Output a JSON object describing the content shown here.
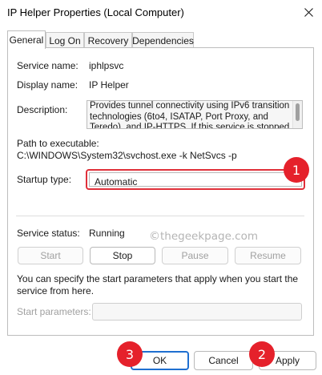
{
  "window": {
    "title": "IP Helper Properties (Local Computer)",
    "close_icon": "close-icon"
  },
  "tabs": [
    {
      "label": "General",
      "active": true
    },
    {
      "label": "Log On",
      "active": false
    },
    {
      "label": "Recovery",
      "active": false
    },
    {
      "label": "Dependencies",
      "active": false
    }
  ],
  "general": {
    "service_name_label": "Service name:",
    "service_name": "iphlpsvc",
    "display_name_label": "Display name:",
    "display_name": "IP Helper",
    "description_label": "Description:",
    "description": "Provides tunnel connectivity using IPv6 transition technologies (6to4, ISATAP, Port Proxy, and Teredo), and IP-HTTPS. If this service is stopped",
    "path_label": "Path to executable:",
    "path": "C:\\WINDOWS\\System32\\svchost.exe -k NetSvcs -p",
    "startup_type_label": "Startup type:",
    "startup_type": "Automatic",
    "service_status_label": "Service status:",
    "service_status": "Running",
    "buttons": {
      "start": "Start",
      "stop": "Stop",
      "pause": "Pause",
      "resume": "Resume"
    },
    "params_help": "You can specify the start parameters that apply when you start the service from here.",
    "start_parameters_label": "Start parameters:",
    "start_parameters_value": ""
  },
  "watermark": {
    "symbol": "©",
    "text": "thegeekpage.com"
  },
  "footer": {
    "ok": "OK",
    "cancel": "Cancel",
    "apply": "Apply"
  },
  "annotations": [
    {
      "number": "1",
      "color": "#e5212b"
    },
    {
      "number": "2",
      "color": "#e5212b"
    },
    {
      "number": "3",
      "color": "#e5212b"
    }
  ]
}
